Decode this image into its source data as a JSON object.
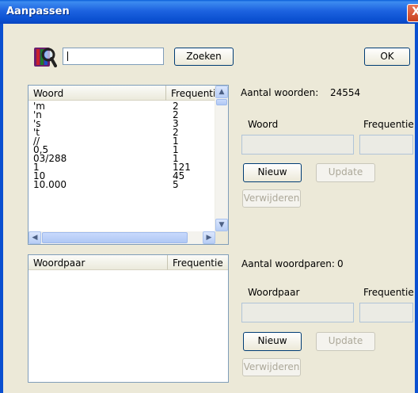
{
  "window": {
    "title": "Aanpassen",
    "close_glyph": "X"
  },
  "search": {
    "value": "",
    "button_label": "Zoeken"
  },
  "ok_label": "OK",
  "words": {
    "columns": [
      "Woord",
      "Frequenti"
    ],
    "rows": [
      [
        "'m",
        "2"
      ],
      [
        "'n",
        "2"
      ],
      [
        "'s",
        "3"
      ],
      [
        "'t",
        "2"
      ],
      [
        "//",
        "1"
      ],
      [
        "0,5",
        "1"
      ],
      [
        "03/288",
        "1"
      ],
      [
        "1",
        "121"
      ],
      [
        "10",
        "45"
      ],
      [
        "10.000",
        "5"
      ]
    ],
    "scroll_up": "▲",
    "scroll_down": "▼",
    "scroll_left": "◀",
    "scroll_right": "▶"
  },
  "word_panel": {
    "count_label": "Aantal woorden:",
    "count_value": "24554",
    "word_label": "Woord",
    "freq_label": "Frequentie",
    "new_label": "Nieuw",
    "update_label": "Update",
    "delete_label": "Verwijderen"
  },
  "pairs": {
    "columns": [
      "Woordpaar",
      "Frequentie"
    ]
  },
  "pair_panel": {
    "count_label": "Aantal woordparen:",
    "count_value": "0",
    "pair_label": "Woordpaar",
    "freq_label": "Frequentie",
    "new_label": "Nieuw",
    "update_label": "Update",
    "delete_label": "Verwijderen"
  }
}
